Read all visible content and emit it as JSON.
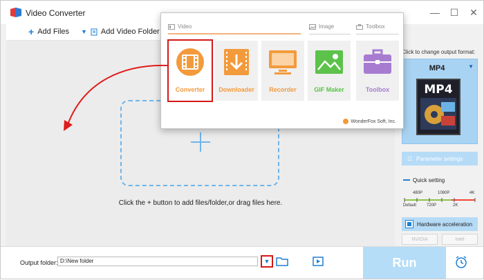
{
  "window": {
    "title": "Video Converter"
  },
  "toolbar": {
    "add_files": "Add Files",
    "add_video_folder": "Add Video Folder"
  },
  "main": {
    "hint": "Click the + button to add files/folder,or drag files here."
  },
  "popup": {
    "categories": {
      "video": "Video",
      "image": "Image",
      "toolbox": "Toolbox"
    },
    "tiles": [
      {
        "label": "Converter",
        "icon": "film-icon",
        "color": "#f39a3c"
      },
      {
        "label": "Downloader",
        "icon": "download-icon",
        "color": "#f39a3c"
      },
      {
        "label": "Recorder",
        "icon": "monitor-icon",
        "color": "#f39a3c"
      },
      {
        "label": "GIF Maker",
        "icon": "image-icon",
        "color": "#5cc24a"
      },
      {
        "label": "Toolbox",
        "icon": "toolbox-icon",
        "color": "#a77cd0"
      }
    ],
    "brand": "WonderFox Soft, Inc."
  },
  "right": {
    "format_prompt": "Click to change output format:",
    "format_name": "MP4",
    "format_icon_text": "MP4",
    "parameter_settings": "Parameter settings",
    "quick_setting": "Quick setting",
    "slider_top": [
      "480P",
      "1080P",
      "4K"
    ],
    "slider_bottom": [
      "Default",
      "720P",
      "2K"
    ],
    "hw_accel": "Hardware acceleration",
    "gpu": [
      "NVIDIA",
      "Intel"
    ]
  },
  "bottom": {
    "output_folder_label": "Output folder:",
    "output_folder_value": "D:\\New folder",
    "run": "Run"
  },
  "colors": {
    "accent": "#1e7fd6",
    "highlight": "#d41717",
    "orange": "#f39a3c"
  }
}
